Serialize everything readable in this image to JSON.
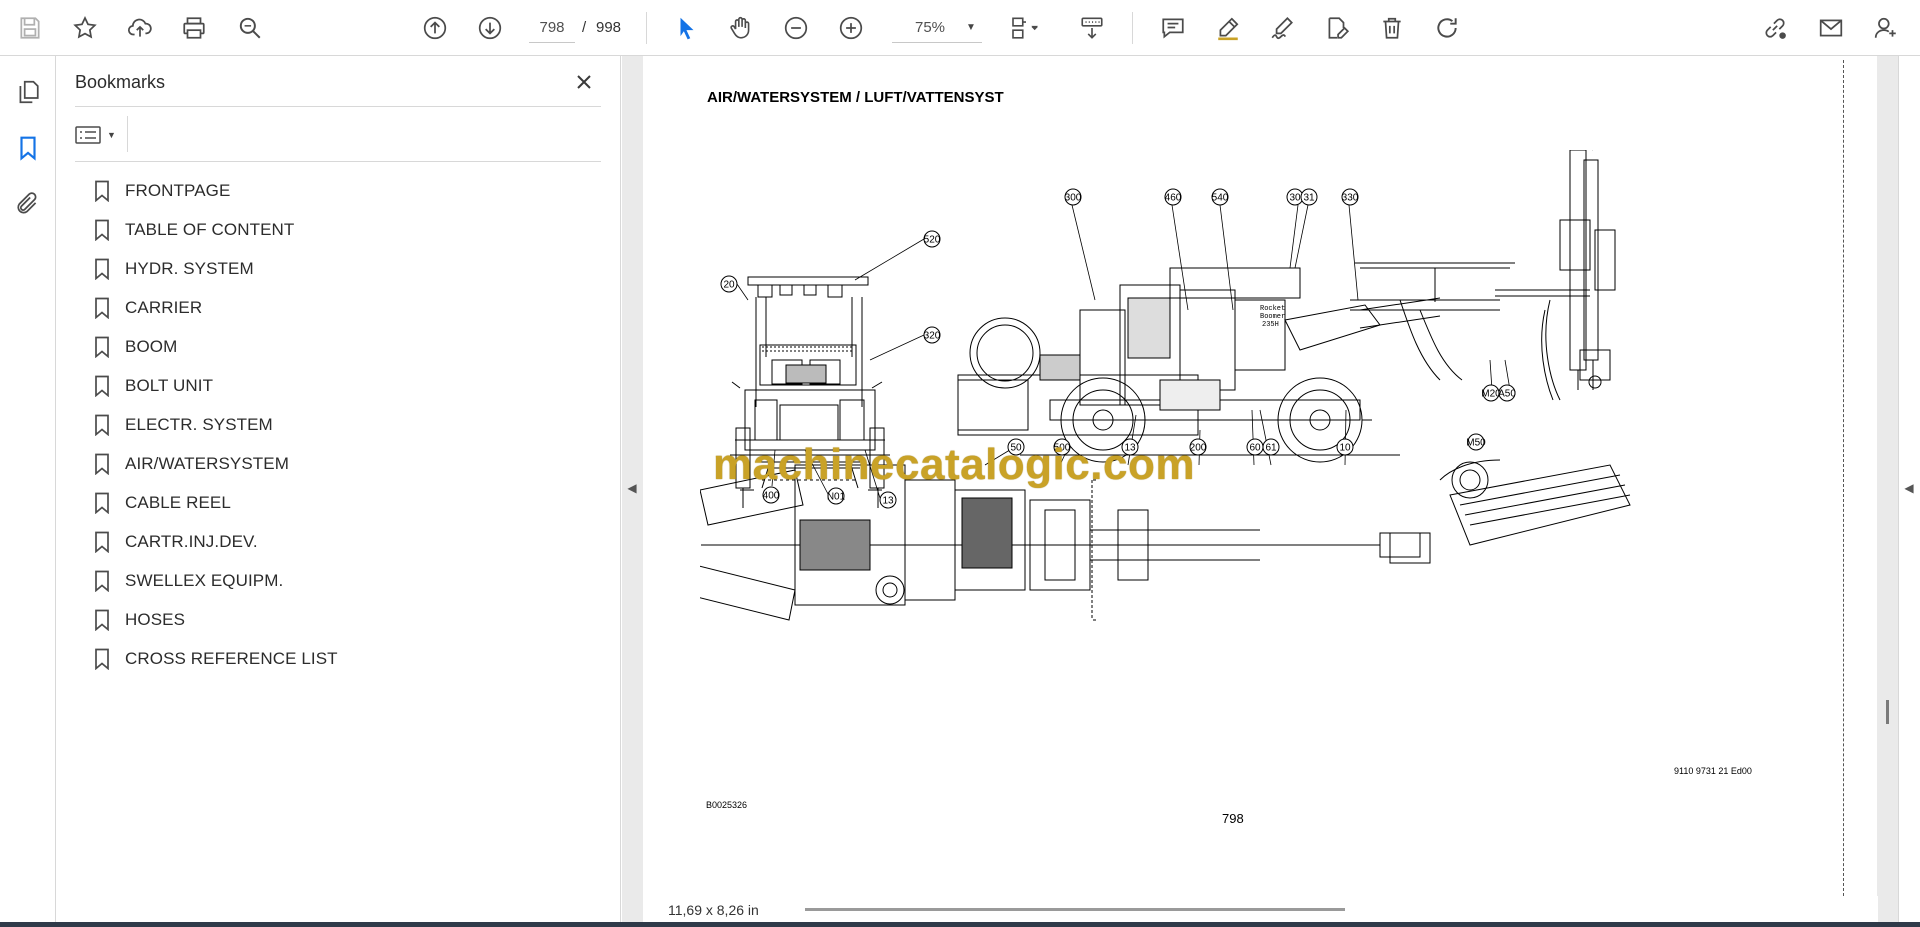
{
  "toolbar": {
    "current_page": "798",
    "page_separator": "/",
    "total_pages": "998",
    "zoom": "75%",
    "icons": [
      "save-icon",
      "bookmark-star-icon",
      "upload-icon",
      "print-icon",
      "find-icon",
      "previous-page-icon",
      "next-page-icon",
      "select-cursor-icon",
      "hand-icon",
      "zoom-out-icon",
      "zoom-in-icon",
      "page-view-icon",
      "scroll-mode-icon",
      "comment-icon",
      "highlight-icon",
      "sign-icon",
      "fill-sign-icon",
      "delete-icon",
      "rotate-icon",
      "share-link-icon",
      "email-icon",
      "account-icon"
    ]
  },
  "left_rail": {
    "icons": [
      "pages-thumbnails-icon",
      "bookmarks-icon",
      "attachments-icon"
    ]
  },
  "bookmarks": {
    "title": "Bookmarks",
    "items": [
      {
        "label": "FRONTPAGE"
      },
      {
        "label": "TABLE OF CONTENT"
      },
      {
        "label": "HYDR. SYSTEM"
      },
      {
        "label": "CARRIER"
      },
      {
        "label": "BOOM"
      },
      {
        "label": "BOLT UNIT"
      },
      {
        "label": "ELECTR. SYSTEM"
      },
      {
        "label": "AIR/WATERSYSTEM"
      },
      {
        "label": "CABLE REEL"
      },
      {
        "label": "CARTR.INJ.DEV."
      },
      {
        "label": "SWELLEX EQUIPM."
      },
      {
        "label": "HOSES"
      },
      {
        "label": "CROSS REFERENCE LIST"
      }
    ]
  },
  "document": {
    "title": "AIR/WATERSYSTEM / LUFT/VATTENSYST",
    "watermark": "machinecatalogic.com",
    "ref_left": "B0025326",
    "ref_right": "9110 9731 21 Ed00",
    "page_number": "798",
    "machine_text": [
      "Rocket",
      "Boomer",
      "235H"
    ],
    "callouts": {
      "front_view": [
        "520",
        "20",
        "320",
        "400",
        "N01",
        "13"
      ],
      "side_view_top": [
        "300",
        "460",
        "540",
        "30",
        "31",
        "330"
      ],
      "side_view_bottom": [
        "50",
        "500",
        "13",
        "200",
        "60",
        "61",
        "10"
      ],
      "side_view_boom": [
        "M20",
        "A50"
      ],
      "plan_view": [
        "M50"
      ]
    }
  },
  "status": {
    "page_size": "11,69 x 8,26 in"
  },
  "colors": {
    "accent_blue": "#1473e6",
    "icon_gray": "#4b4b4b",
    "watermark": "#c9a227",
    "doc_background": "#eaeaea"
  }
}
